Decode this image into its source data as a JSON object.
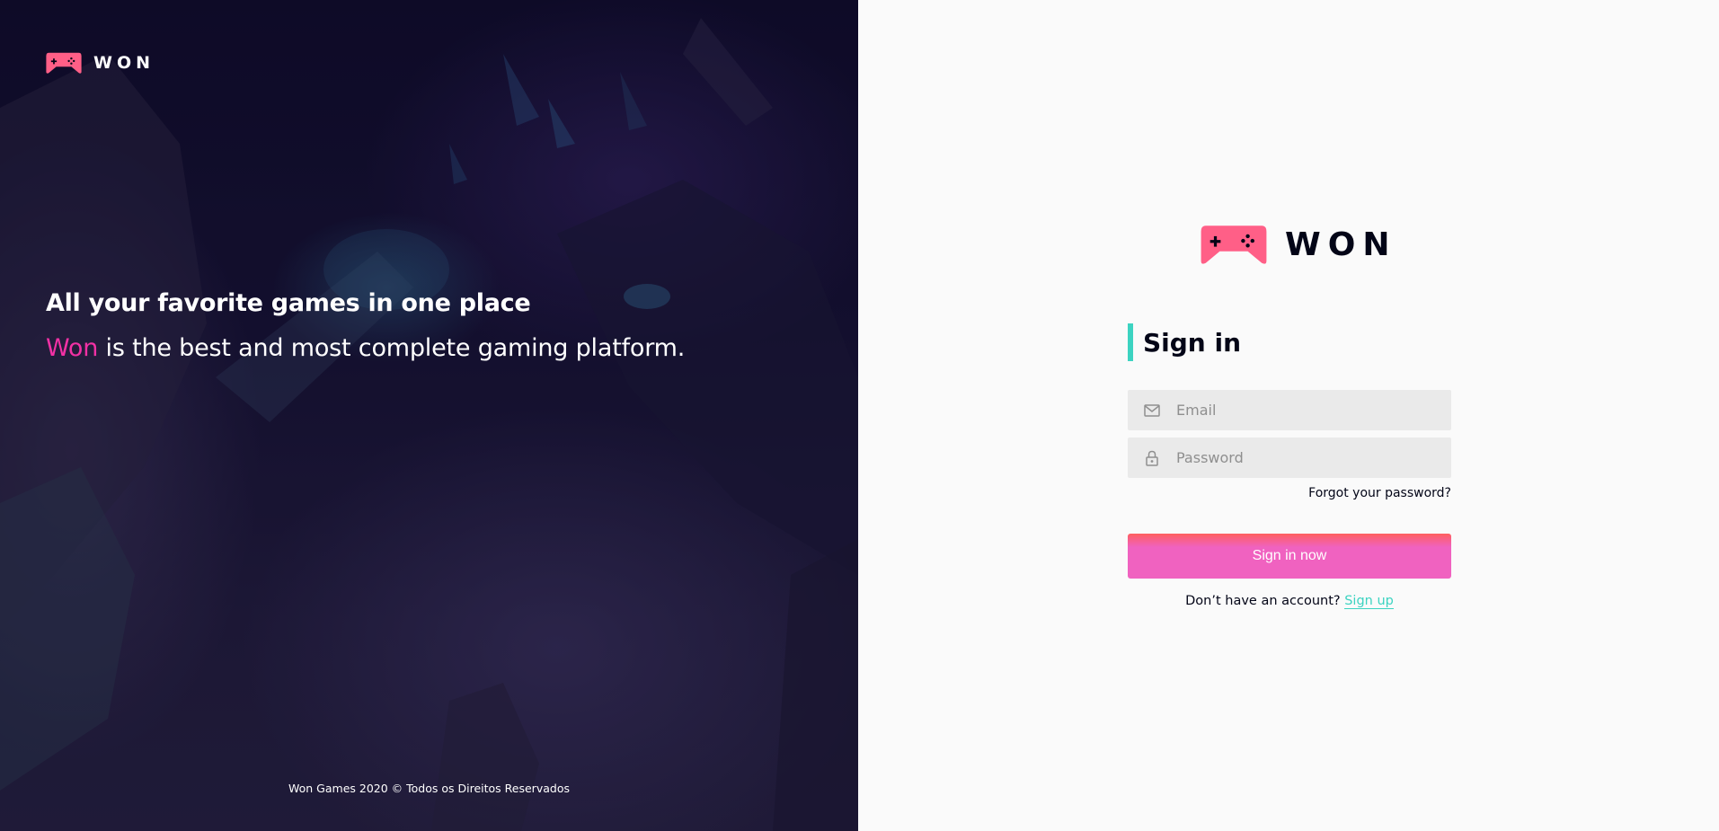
{
  "banner": {
    "logo_text": "WON",
    "heading": "All your favorite games in one place",
    "subtitle_brand": "Won",
    "subtitle_rest": " is the best and most complete gaming platform.",
    "footer": "Won Games 2020 © Todos os Direitos Reservados"
  },
  "panel": {
    "logo_text": "WON",
    "title": "Sign in",
    "email": {
      "icon": "mail-icon",
      "placeholder": "Email",
      "value": ""
    },
    "password": {
      "icon": "lock-icon",
      "placeholder": "Password",
      "value": ""
    },
    "forgot_label": "Forgot your password?",
    "submit_label": "Sign in now",
    "signup_prompt": "Don’t have an account? ",
    "signup_link": "Sign up"
  },
  "colors": {
    "brand_pink": "#f231a5",
    "logo_pink": "#ff5f87",
    "accent_teal": "#3cd3c1",
    "button_gradient": [
      "#ff5f5f",
      "#f062c0"
    ],
    "dark_text": "#030517"
  }
}
